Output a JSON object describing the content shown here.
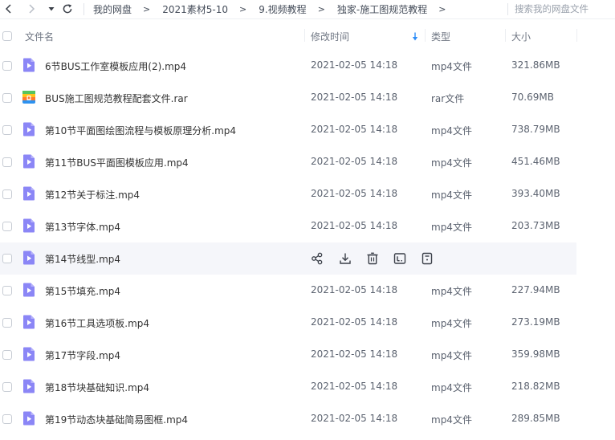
{
  "nav": {
    "breadcrumbs": [
      {
        "label": "我的网盘"
      },
      {
        "label": "2021素材5-10"
      },
      {
        "label": "9.视频教程"
      },
      {
        "label": "独家-施工图规范教程"
      }
    ],
    "separator": ">",
    "search_placeholder": "搜索我的网盘文件"
  },
  "header": {
    "name": "文件名",
    "modified": "修改时间",
    "type": "类型",
    "size": "大小"
  },
  "colors": {
    "video_icon": "#8b86f6",
    "rar_icon_blue": "#2d92f0",
    "rar_icon_orange": "#ff7a2e",
    "rar_icon_yellow": "#ffc21a",
    "rar_icon_green": "#57c45e",
    "sort_arrow": "#2e8df8",
    "hover_row": "#f5f6fa"
  },
  "rows": [
    {
      "icon": "video-file-icon",
      "name": "6节BUS工作室模板应用(2).mp4",
      "modified": "2021-02-05 14:18",
      "type": "mp4文件",
      "size": "321.86MB"
    },
    {
      "icon": "rar-file-icon",
      "name": "BUS施工图规范教程配套文件.rar",
      "modified": "2021-02-05 14:18",
      "type": "rar文件",
      "size": "70.69MB"
    },
    {
      "icon": "video-file-icon",
      "name": "第10节平面图绘图流程与模板原理分析.mp4",
      "modified": "2021-02-05 14:18",
      "type": "mp4文件",
      "size": "738.79MB"
    },
    {
      "icon": "video-file-icon",
      "name": "第11节BUS平面图模板应用.mp4",
      "modified": "2021-02-05 14:18",
      "type": "mp4文件",
      "size": "451.46MB"
    },
    {
      "icon": "video-file-icon",
      "name": "第12节关于标注.mp4",
      "modified": "2021-02-05 14:18",
      "type": "mp4文件",
      "size": "393.40MB"
    },
    {
      "icon": "video-file-icon",
      "name": "第13节字体.mp4",
      "modified": "2021-02-05 14:18",
      "type": "mp4文件",
      "size": "203.73MB"
    },
    {
      "icon": "video-file-icon",
      "name": "第14节线型.mp4",
      "modified": "",
      "type": "",
      "size": "",
      "hovered": true,
      "actions": [
        "share-icon",
        "download-icon",
        "delete-icon",
        "rename-icon",
        "more-icon"
      ]
    },
    {
      "icon": "video-file-icon",
      "name": "第15节填充.mp4",
      "modified": "2021-02-05 14:18",
      "type": "mp4文件",
      "size": "227.94MB"
    },
    {
      "icon": "video-file-icon",
      "name": "第16节工具选项板.mp4",
      "modified": "2021-02-05 14:18",
      "type": "mp4文件",
      "size": "273.19MB"
    },
    {
      "icon": "video-file-icon",
      "name": "第17节字段.mp4",
      "modified": "2021-02-05 14:18",
      "type": "mp4文件",
      "size": "359.98MB"
    },
    {
      "icon": "video-file-icon",
      "name": "第18节块基础知识.mp4",
      "modified": "2021-02-05 14:18",
      "type": "mp4文件",
      "size": "218.82MB"
    },
    {
      "icon": "video-file-icon",
      "name": "第19节动态块基础简易图框.mp4",
      "modified": "2021-02-05 14:18",
      "type": "mp4文件",
      "size": "289.85MB"
    }
  ]
}
